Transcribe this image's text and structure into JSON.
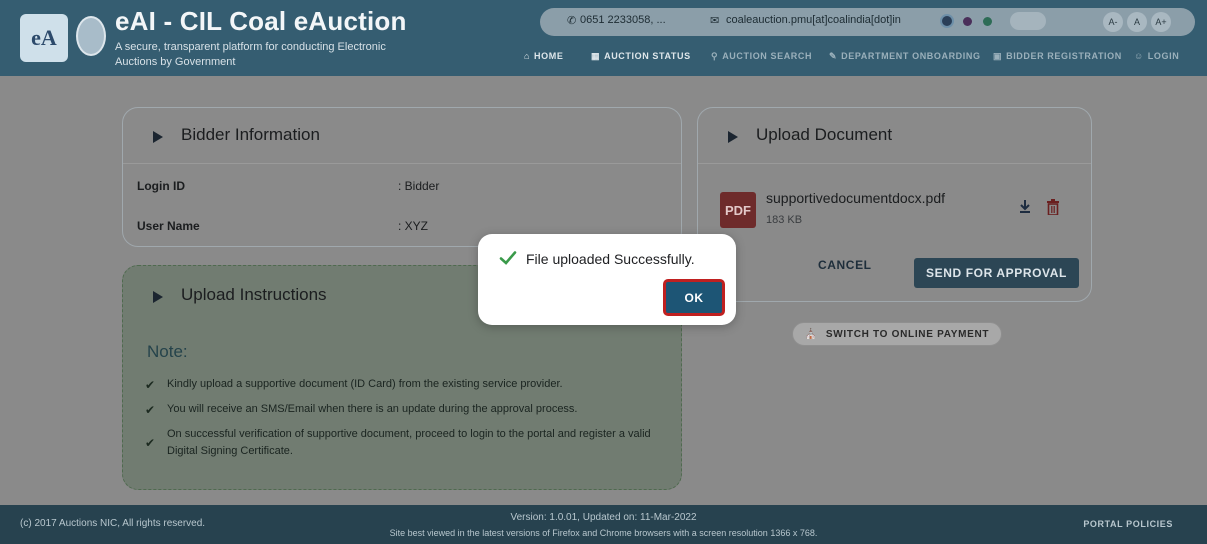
{
  "header": {
    "logo_text": "eA",
    "title": "eAI - CIL Coal eAuction",
    "subtitle": "A secure, transparent platform for conducting Electronic Auctions by Government",
    "phone": "0651 2233058, ...",
    "email": "coaleauction.pmu[at]coalindia[dot]in",
    "font_small": "A-",
    "font_normal": "A",
    "font_large": "A+"
  },
  "nav": {
    "home": "HOME",
    "auction_status": "AUCTION STATUS",
    "auction_search": "AUCTION SEARCH",
    "department_onboarding": "DEPARTMENT ONBOARDING",
    "bidder_registration": "BIDDER REGISTRATION",
    "login": "LOGIN"
  },
  "bidder_info": {
    "title": "Bidder Information",
    "login_id_label": "Login ID",
    "login_id_value": ": Bidder",
    "user_name_label": "User Name",
    "user_name_value": ": XYZ"
  },
  "upload_document": {
    "title": "Upload Document",
    "file_icon_text": "PDF",
    "file_name": "supportivedocumentdocx.pdf",
    "file_size": "183 KB",
    "cancel_label": "CANCEL",
    "send_label": "SEND FOR APPROVAL"
  },
  "switch_payment_label": "SWITCH TO ONLINE PAYMENT",
  "instructions": {
    "title": "Upload Instructions",
    "note": "Note:",
    "items": [
      "Kindly upload a supportive document (ID Card) from the existing service provider.",
      "You will receive an SMS/Email when there is an update during the approval process.",
      "On successful verification of supportive document, proceed to login to the portal and register a valid Digital Signing Certificate."
    ]
  },
  "dialog": {
    "message": "File uploaded Successfully.",
    "ok_label": "OK"
  },
  "footer": {
    "copyright": "(c) 2017 Auctions NIC, All rights reserved.",
    "version": "Version: 1.0.01, Updated on: 11-Mar-2022",
    "browser_note": "Site best viewed in the latest versions of Firefox and Chrome browsers with a screen resolution 1366 x 768.",
    "portal_policies": "PORTAL POLICIES"
  }
}
